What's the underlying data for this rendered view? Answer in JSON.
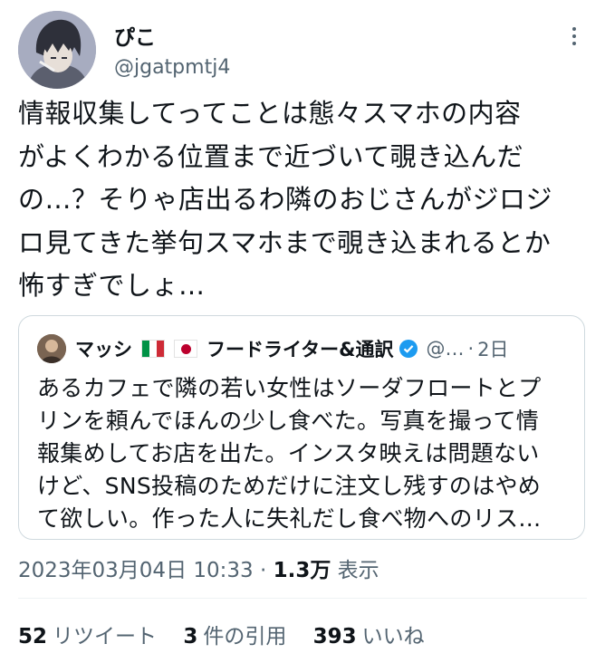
{
  "author": {
    "display_name": "ぴこ",
    "handle": "@jgatpmtj4",
    "avatar_icon": "anime-avatar-icon"
  },
  "tweet": {
    "text": "情報収集してってことは態々スマホの内容\nがよくわかる位置まで近づいて覗き込んだ\nの…？そりゃ店出るわ隣のおじさんがジロジ\nロ見てきた挙句スマホまで覗き込まれるとか\n怖すぎでしょ…"
  },
  "quote": {
    "name_part1": "マッシ",
    "name_part2": "フードライター&通訳",
    "handle_truncated": "@…",
    "separator": "·",
    "time": "2日",
    "text": "あるカフェで隣の若い女性はソーダフロートとプ\nリンを頼んでほんの少し食べた。写真を撮って情\n報集めしてお店を出た。インスタ映えは問題ない\nけど、SNS投稿のためだけに注文し残すのはやめ\nて欲しい。作った人に失礼だし食べ物へのリス…"
  },
  "meta": {
    "timestamp": "2023年03月04日 10:33",
    "dot": "·",
    "views_count": "1.3万",
    "views_label": "表示"
  },
  "stats": {
    "retweets_count": "52",
    "retweets_label": "リツイート",
    "quotes_count": "3",
    "quotes_label": "件の引用",
    "likes_count": "393",
    "likes_label": "いいね"
  },
  "colors": {
    "text": "#0f1419",
    "secondary": "#536471",
    "border": "#cfd9de",
    "verified": "#1d9bf0"
  }
}
